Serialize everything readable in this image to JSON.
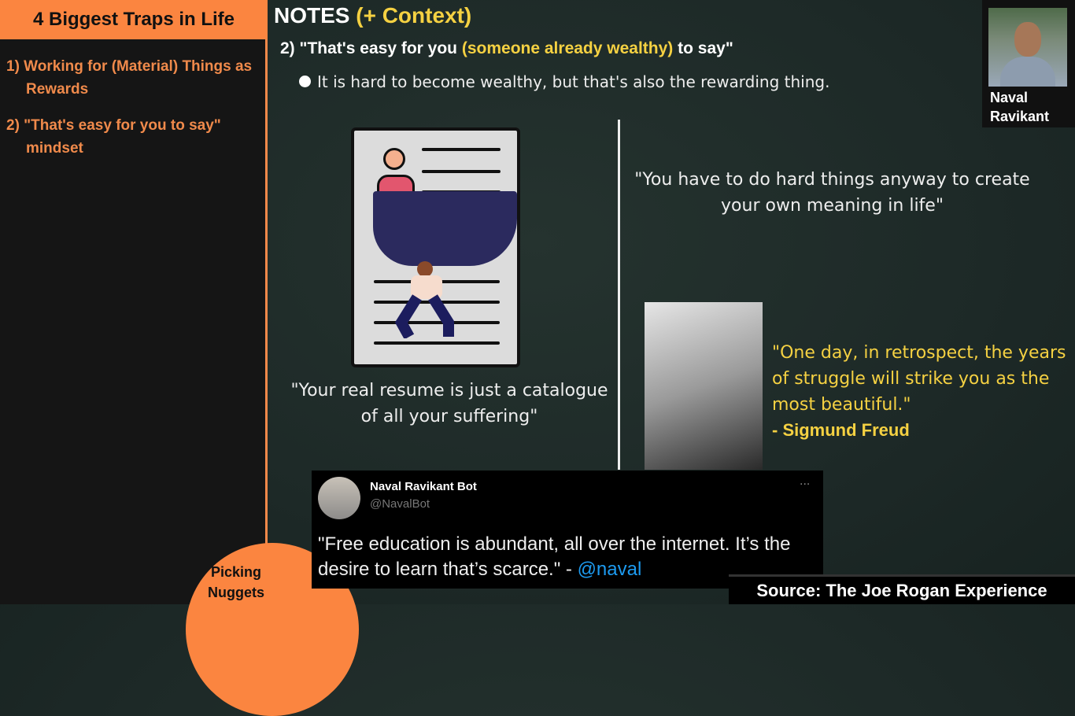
{
  "sidebar": {
    "title": "4 Biggest Traps in Life",
    "items": [
      {
        "label": "1) Working for (Material) Things as Rewards"
      },
      {
        "label": "2) \"That's easy for you to say\" mindset"
      }
    ],
    "brand": "Picking Nuggets"
  },
  "header": {
    "title": "NOTES",
    "context": "(+ Context)"
  },
  "point": {
    "pre": "2) \"That's easy for you ",
    "highlight": "(someone already wealthy)",
    "post": " to say\""
  },
  "bullet": "It is hard to become wealthy, but that's also the rewarding thing.",
  "speaker": {
    "name": "Naval Ravikant"
  },
  "quotes": {
    "resume": "\"Your real resume is just a catalogue of all your suffering\"",
    "hard_things": "\"You have to do hard things anyway to create your own meaning in life\"",
    "freud": "\"One day, in retrospect, the years of struggle will strike you as the most beautiful.\"",
    "freud_author": "- Sigmund Freud"
  },
  "tweet": {
    "name": "Naval Ravikant Bot",
    "handle": "@NavalBot",
    "more": "···",
    "text": "\"Free education is abundant, all over the internet. It’s the desire to learn that’s scarce.\" - ",
    "link": "@naval"
  },
  "source": "Source: The Joe Rogan Experience",
  "colors": {
    "orange": "#fb8540",
    "yellow": "#f5d142",
    "link": "#1d9bf0"
  }
}
